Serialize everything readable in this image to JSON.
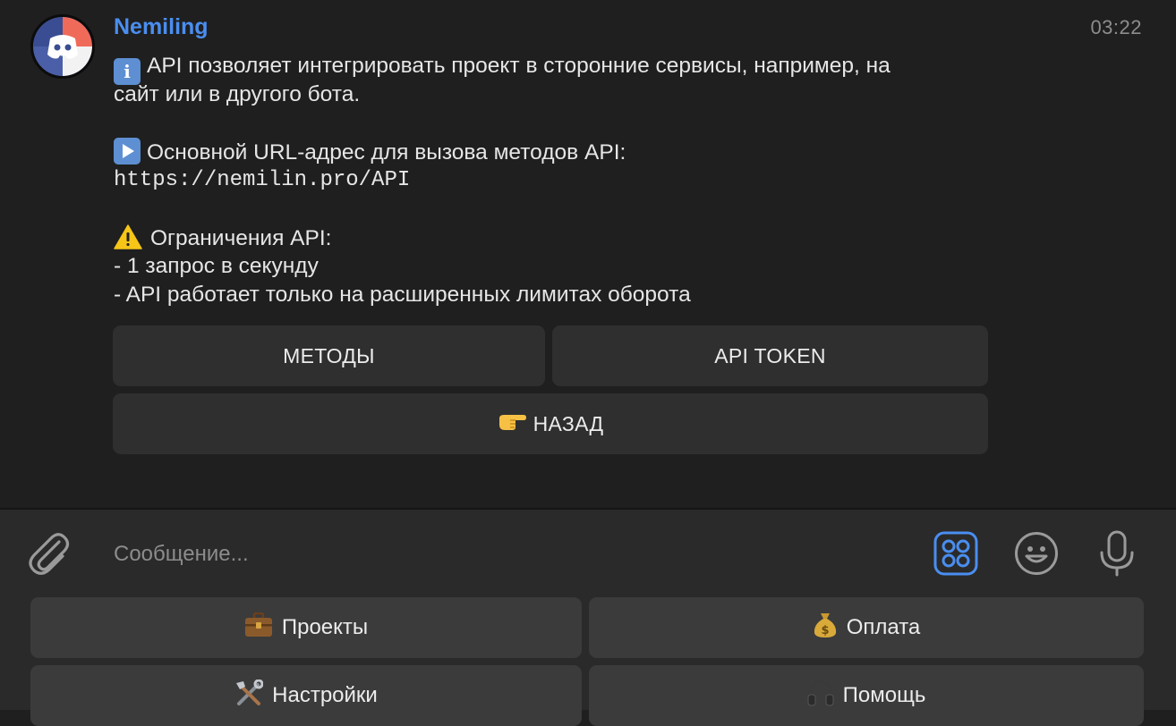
{
  "chat": {
    "sender": "Nemiling",
    "time": "03:22"
  },
  "message": {
    "intro_line1": "API позволяет интегрировать проект в сторонние сервисы, например, на",
    "intro_line2": "сайт или в другого бота.",
    "url_heading": "Основной URL-адрес для вызова методов API:",
    "url": "https://nemilin.pro/API",
    "limits_heading": "Ограничения API:",
    "limit1": "- 1 запрос в секунду",
    "limit2": "- API работает только на расширенных лимитах оборота"
  },
  "inline_keyboard": {
    "methods": "МЕТОДЫ",
    "api_token": "API TOKEN",
    "back": "НАЗАД"
  },
  "composer": {
    "placeholder": "Сообщение..."
  },
  "reply_keyboard": {
    "projects": "Проекты",
    "payment": "Оплата",
    "settings": "Настройки",
    "help": "Помощь"
  },
  "colors": {
    "accent": "#4a8ef0",
    "background": "#1f1f1f",
    "button": "#2f2f2f"
  }
}
